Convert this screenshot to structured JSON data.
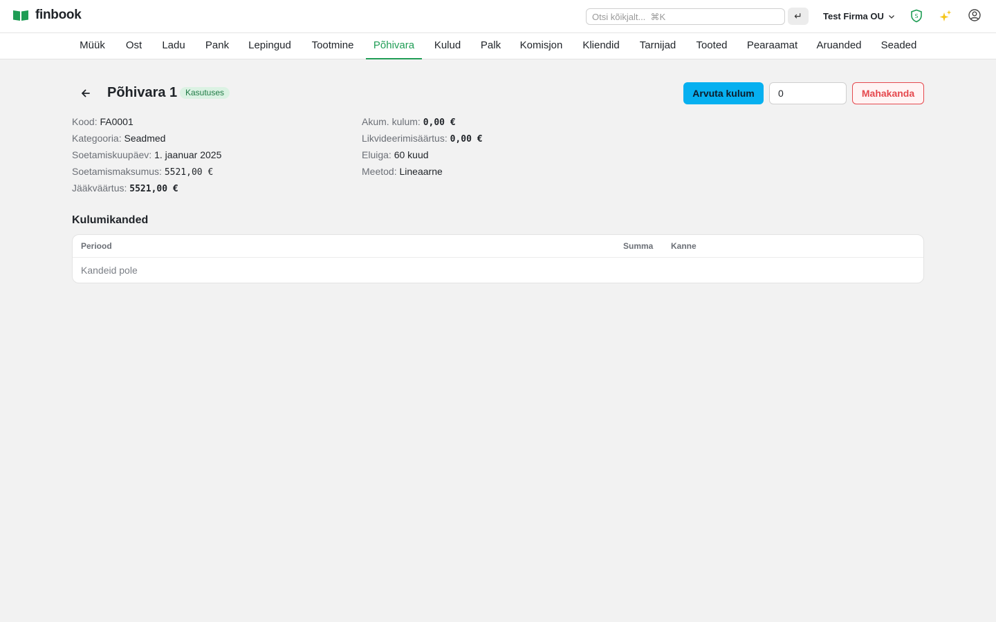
{
  "app": {
    "name": "finbook"
  },
  "header": {
    "search_placeholder": "Otsi kõikjalt...  ⌘K",
    "enter_symbol": "↵",
    "company": "Test Firma OU",
    "shield_letter": "S"
  },
  "nav": {
    "items": [
      {
        "label": "Müük"
      },
      {
        "label": "Ost"
      },
      {
        "label": "Ladu"
      },
      {
        "label": "Pank"
      },
      {
        "label": "Lepingud"
      },
      {
        "label": "Tootmine"
      },
      {
        "label": "Põhivara"
      },
      {
        "label": "Kulud"
      },
      {
        "label": "Palk"
      },
      {
        "label": "Komisjon"
      },
      {
        "label": "Kliendid"
      },
      {
        "label": "Tarnijad"
      },
      {
        "label": "Tooted"
      },
      {
        "label": "Pearaamat"
      },
      {
        "label": "Aruanded"
      },
      {
        "label": "Seaded"
      }
    ],
    "active": "Põhivara"
  },
  "asset": {
    "title": "Põhivara 1",
    "status": "Kasutuses",
    "actions": {
      "calculate_label": "Arvuta kulum",
      "months_value": "0",
      "write_off_label": "Mahakanda"
    },
    "fields": {
      "code_label": "Kood:",
      "code": "FA0001",
      "category_label": "Kategooria:",
      "category": "Seadmed",
      "acquisition_date_label": "Soetamiskuupäev:",
      "acquisition_date": "1. jaanuar 2025",
      "acquisition_cost_label": "Soetamismaksumus:",
      "acquisition_cost": "5521,00 €",
      "residual_value_label": "Jääkväärtus:",
      "residual_value": "5521,00 €",
      "accumulated_label": "Akum. kulum:",
      "accumulated": "0,00 €",
      "salvage_label": "Likvideerimisäärtus:",
      "salvage": "0,00 €",
      "lifetime_label": "Eluiga:",
      "lifetime": "60 kuud",
      "method_label": "Meetod:",
      "method": "Lineaarne"
    }
  },
  "entries": {
    "title": "Kulumikanded",
    "columns": {
      "period": "Periood",
      "amount": "Summa",
      "entry": "Kanne"
    },
    "empty_text": "Kandeid pole"
  },
  "colors": {
    "accent_green": "#1f9d55",
    "primary_blue": "#06b0f0",
    "danger_red": "#e5484d",
    "badge_bg": "#dbf2e3"
  }
}
